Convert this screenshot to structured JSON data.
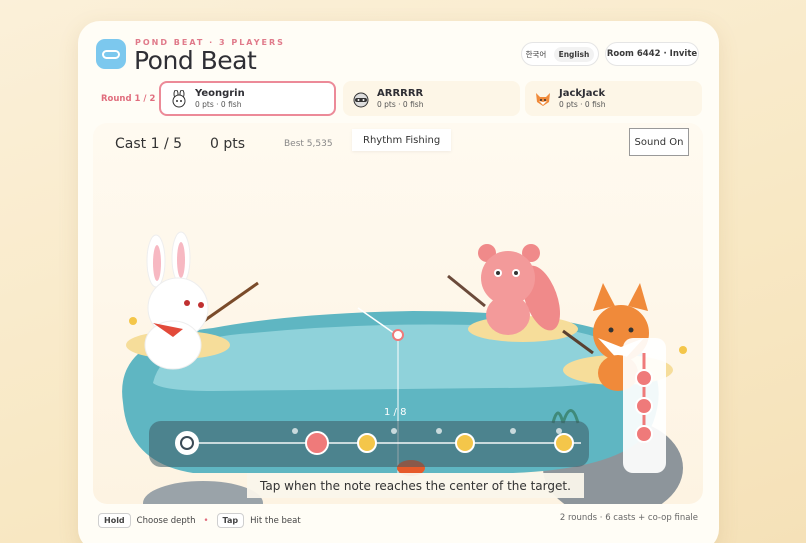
{
  "header": {
    "kicker": "POND BEAT · 3 PLAYERS",
    "title": "Pond Beat",
    "lang_ko": "한국어",
    "lang_en": "English",
    "room": "Room 6442 · Invite"
  },
  "round_label": "Round 1 / 2",
  "players": [
    {
      "name": "Yeongrin",
      "stats": "0 pts · 0 fish",
      "avatar": "rabbit-icon",
      "active": true
    },
    {
      "name": "ARRRRR",
      "stats": "0 pts · 0 fish",
      "avatar": "raccoon-icon",
      "active": false
    },
    {
      "name": "JackJack",
      "stats": "0 pts · 0 fish",
      "avatar": "fox-icon",
      "active": false
    }
  ],
  "hud": {
    "cast": "Cast 1 / 5",
    "points": "0 pts",
    "best": "Best 5,535",
    "mode": "Rhythm Fishing",
    "sound": "Sound On",
    "beat": "1 / 8"
  },
  "hint": "Tap when the note reaches the center of the target.",
  "footer": {
    "hold_key": "Hold",
    "hold_text": "Choose depth",
    "tap_key": "Tap",
    "tap_text": "Hit the beat",
    "summary": "2 rounds · 6 casts + co-op finale"
  },
  "colors": {
    "accent": "#ec8a98",
    "pond": "#7cc8d2",
    "note_gold": "#f4c64a",
    "note_red": "#ef7a7a"
  }
}
